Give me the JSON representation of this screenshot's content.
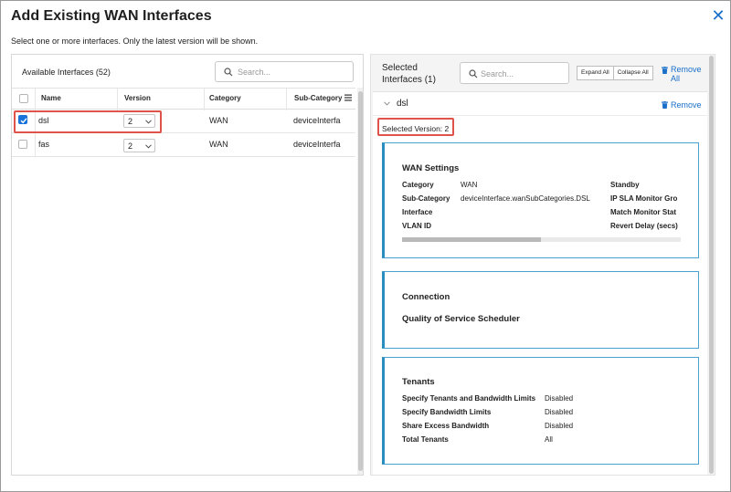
{
  "dialog": {
    "title": "Add Existing WAN Interfaces",
    "subtitle": "Select one or more interfaces. Only the latest version will be shown.",
    "close_icon": "close-icon",
    "accent_color": "#1a6fc9",
    "highlight_color": "#e0534a"
  },
  "available": {
    "label": "Available Interfaces (52)",
    "search_placeholder": "Search...",
    "columns": [
      "Name",
      "Version",
      "Category",
      "Sub-Category"
    ],
    "rows": [
      {
        "name": "dsl",
        "version": "2",
        "category": "WAN",
        "subcategory": "deviceInterfa",
        "checked": true
      },
      {
        "name": "fas",
        "version": "2",
        "category": "WAN",
        "subcategory": "deviceInterfa",
        "checked": false
      }
    ]
  },
  "selected": {
    "title": "Selected Interfaces (1)",
    "search_placeholder": "Search...",
    "expand_all": "Expand All",
    "collapse_all": "Collapse All",
    "remove_all": "Remove All",
    "item": {
      "name": "dsl",
      "remove": "Remove",
      "selected_version": "Selected Version: 2"
    },
    "wan_settings": {
      "title": "WAN Settings",
      "labels": {
        "category": "Category",
        "subcategory": "Sub-Category",
        "interface": "Interface",
        "vlan": "VLAN ID",
        "standby": "Standby",
        "ipsla": "IP SLA Monitor Gro",
        "match": "Match Monitor Stat",
        "revert": "Revert Delay (secs)"
      },
      "values": {
        "category": "WAN",
        "subcategory": "deviceInterface.wanSubCategories.DSL"
      }
    },
    "connection": {
      "title": "Connection",
      "qos": "Quality of Service Scheduler"
    },
    "tenants": {
      "title": "Tenants",
      "rows": [
        {
          "label": "Specify Tenants and Bandwidth Limits",
          "value": "Disabled"
        },
        {
          "label": "Specify Bandwidth Limits",
          "value": "Disabled"
        },
        {
          "label": "Share Excess Bandwidth",
          "value": "Disabled"
        },
        {
          "label": "Total Tenants",
          "value": "All"
        }
      ]
    }
  }
}
